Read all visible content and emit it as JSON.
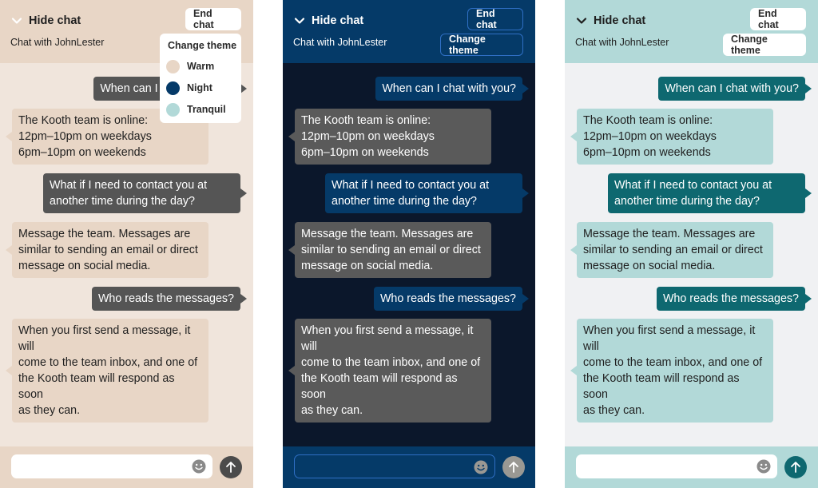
{
  "header": {
    "hide_chat_label": "Hide chat",
    "subtitle": "Chat with JohnLester",
    "end_chat_label": "End chat",
    "change_theme_label": "Change theme"
  },
  "theme_menu": {
    "title": "Change theme",
    "options": [
      {
        "label": "Warm",
        "color": "#e8d6c6"
      },
      {
        "label": "Night",
        "color": "#053a68"
      },
      {
        "label": "Tranquil",
        "color": "#b2d9d8"
      }
    ]
  },
  "themes": [
    {
      "name": "Warm",
      "header_bg": "#e8d6c6",
      "chat_bg": "#f0e5dc",
      "user_bubble": "#555555",
      "bot_bubble": "#e8d6c6",
      "menu_open": true
    },
    {
      "name": "Night",
      "header_bg": "#053a68",
      "chat_bg": "#0b172b",
      "user_bubble": "#053a68",
      "bot_bubble": "#5a5a5a",
      "menu_open": false
    },
    {
      "name": "Tranquil",
      "header_bg": "#b2d9d8",
      "chat_bg": "#f0f1f3",
      "user_bubble": "#0e6870",
      "bot_bubble": "#b2d9d8",
      "menu_open": false
    }
  ],
  "messages": [
    {
      "sender": "user",
      "text": "When can I chat with you?"
    },
    {
      "sender": "bot",
      "text": "The Kooth team is online:\n12pm–10pm on weekdays\n6pm–10pm on weekends"
    },
    {
      "sender": "user",
      "text": "What if I need to contact you at\nanother time during the day?"
    },
    {
      "sender": "bot",
      "text": "Message the team. Messages are\nsimilar to sending an email or direct\nmessage on social media."
    },
    {
      "sender": "user",
      "text": "Who reads the messages?"
    },
    {
      "sender": "bot",
      "text": "When you first send a message, it will\ncome to the team inbox, and one of\nthe Kooth team will respond as soon\nas they can."
    }
  ],
  "composer": {
    "input_value": "",
    "emoji_icon": "smiley-icon",
    "send_icon": "arrow-up-icon"
  }
}
